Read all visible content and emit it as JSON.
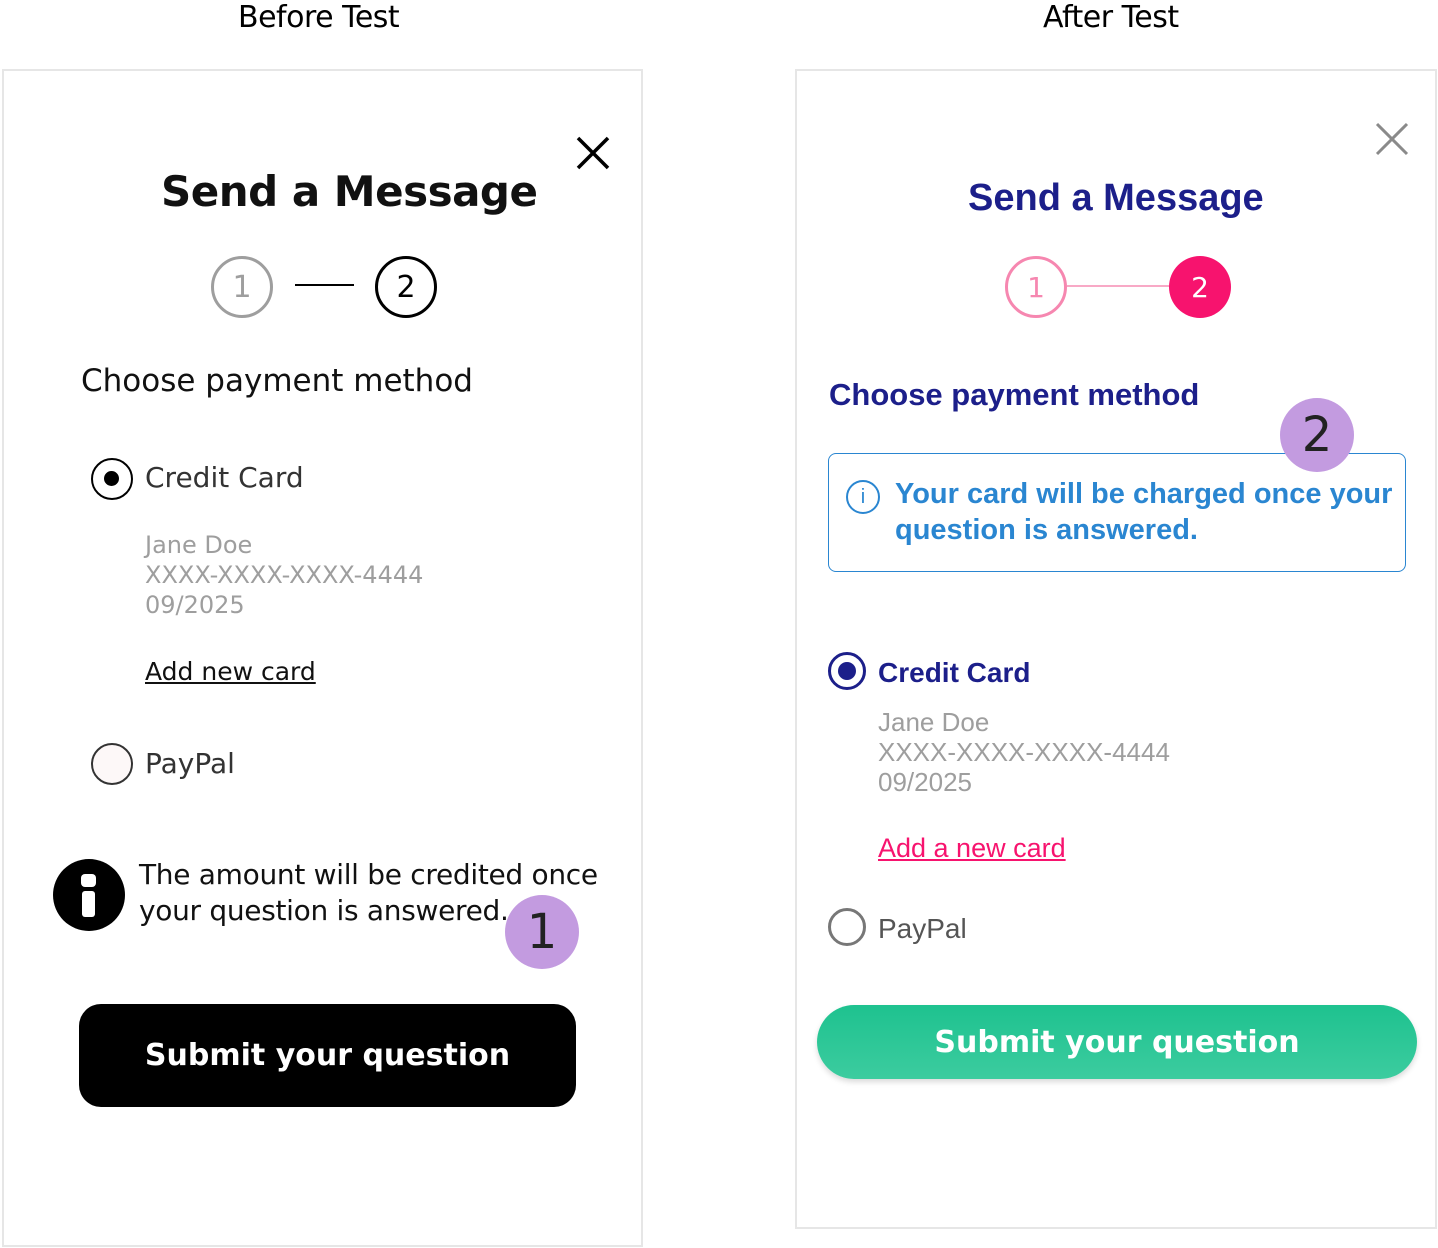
{
  "captions": {
    "before": "Before Test",
    "after": "After Test"
  },
  "before": {
    "title": "Send a Message",
    "steps": [
      "1",
      "2"
    ],
    "section": "Choose payment method",
    "credit_card_label": "Credit Card",
    "card": {
      "name": "Jane Doe",
      "number": "XXXX-XXXX-XXXX-4444",
      "expiry": "09/2025"
    },
    "add_card": "Add new card",
    "paypal_label": "PayPal",
    "info_line1": "The amount will be credited once",
    "info_line2": "your question is answered.",
    "badge": "1",
    "submit": "Submit your question"
  },
  "after": {
    "title": "Send a Message",
    "steps": [
      "1",
      "2"
    ],
    "section": "Choose payment method",
    "badge": "2",
    "notice_line1": "Your card will be charged once your",
    "notice_line2": "question is answered.",
    "credit_card_label": "Credit Card",
    "card": {
      "name": "Jane Doe",
      "number": "XXXX-XXXX-XXXX-4444",
      "expiry": "09/2025"
    },
    "add_card": "Add a new card",
    "paypal_label": "PayPal",
    "submit": "Submit your question"
  },
  "colors": {
    "navy": "#1c1f8a",
    "pink": "#f7136e",
    "pink_light": "#f687b0",
    "info_blue": "#2a86d1",
    "green": "#1ec28f",
    "badge_purple": "#c39be0"
  }
}
